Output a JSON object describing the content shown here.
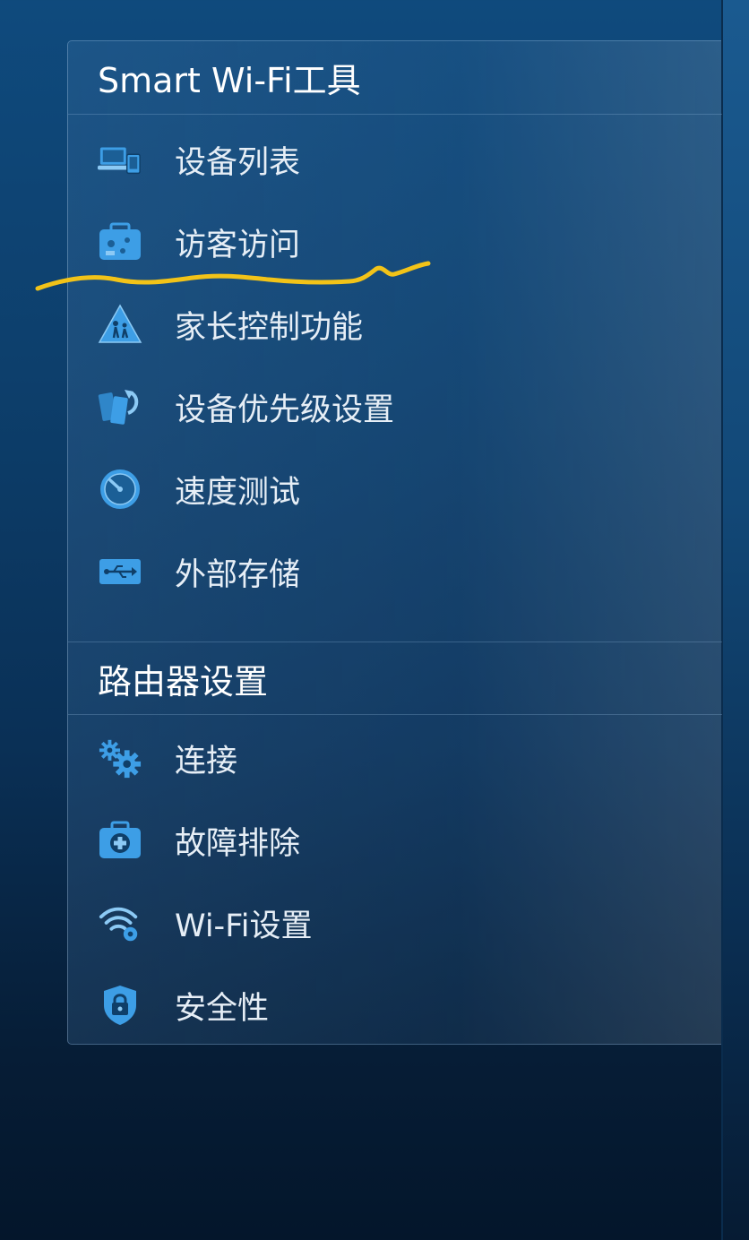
{
  "sections": [
    {
      "title": "Smart Wi-Fi工具",
      "items": [
        {
          "label": "设备列表",
          "icon": "devices-icon"
        },
        {
          "label": "访客访问",
          "icon": "guest-access-icon"
        },
        {
          "label": "家长控制功能",
          "icon": "parental-controls-icon"
        },
        {
          "label": "设备优先级设置",
          "icon": "device-priority-icon"
        },
        {
          "label": "速度测试",
          "icon": "speedometer-icon"
        },
        {
          "label": "外部存储",
          "icon": "usb-storage-icon"
        }
      ]
    },
    {
      "title": "路由器设置",
      "items": [
        {
          "label": "连接",
          "icon": "gears-icon"
        },
        {
          "label": "故障排除",
          "icon": "first-aid-kit-icon"
        },
        {
          "label": "Wi-Fi设置",
          "icon": "wifi-settings-icon"
        },
        {
          "label": "安全性",
          "icon": "security-shield-icon"
        }
      ]
    }
  ],
  "colors": {
    "icon_primary": "#3d9ee6",
    "icon_light": "#8ccaf5",
    "annotation": "#f2c318"
  }
}
